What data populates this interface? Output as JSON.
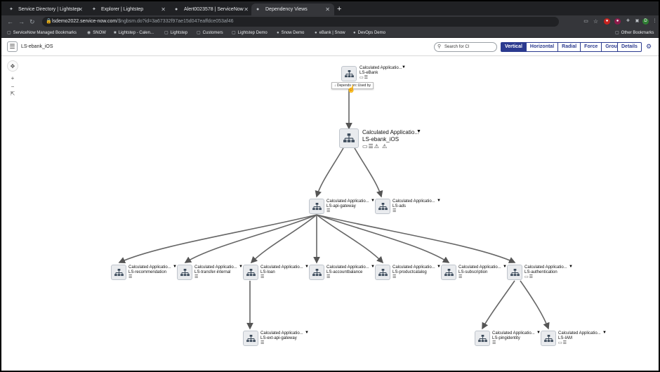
{
  "browser": {
    "tabs": [
      {
        "label": "Service Directory | Lightstep",
        "icon": "lightstep-icon"
      },
      {
        "label": "Explorer | Lightstep",
        "icon": "lightstep-icon"
      },
      {
        "label": "Alert0023578 | ServiceNow",
        "icon": "servicenow-icon"
      },
      {
        "label": "Dependency Views",
        "icon": "servicenow-icon"
      }
    ],
    "new_tab": "+",
    "url_host": "lsdemo2022.service-now.com",
    "url_path": "/$ngbsm.do?id=3a67332f97ae15d047eaffdce053af46",
    "profile_initial": "D",
    "bookmarks": [
      "ServiceNow Managed Bookmarks",
      "SNOW",
      "Lightstep - Calen...",
      "Lightstep",
      "Customers",
      "Lightstep Demo",
      "Snow Demo",
      "eBank | Snow",
      "DevOps Demo"
    ],
    "other_bookmarks": "Other Bookmarks"
  },
  "app": {
    "title": "LS-ebank_iOS",
    "search_placeholder": "Search for CI",
    "views": [
      "Vertical",
      "Horizontal",
      "Radial",
      "Force",
      "Group"
    ],
    "active_view": "Vertical",
    "details_label": "Details"
  },
  "graph": {
    "tooltip": "↓ Depends on::Used by",
    "nodes": [
      {
        "id": "ebank",
        "cls": "Calculated Applicatio...",
        "name": "LS-eBank",
        "badges": "▭☰"
      },
      {
        "id": "ebank_ios",
        "cls": "Calculated Applicatio...",
        "name": "LS-ebank_iOS",
        "badges": "▭☰⚠ ⚠"
      },
      {
        "id": "api_gateway",
        "cls": "Calculated Applicatio...",
        "name": "LS-api-gateway",
        "badges": "☰"
      },
      {
        "id": "ads",
        "cls": "Calculated Applicatio...",
        "name": "LS-ads",
        "badges": "☰"
      },
      {
        "id": "recommendation",
        "cls": "Calculated Applicatio...",
        "name": "LS-recommendation",
        "badges": "☰"
      },
      {
        "id": "transfer_internal",
        "cls": "Calculated Applicatio...",
        "name": "LS-transfer-internal",
        "badges": "☰"
      },
      {
        "id": "loan",
        "cls": "Calculated Applicatio...",
        "name": "LS-loan",
        "badges": "☰"
      },
      {
        "id": "accountbalance",
        "cls": "Calculated Applicatio...",
        "name": "LS-accountbalance",
        "badges": "☰"
      },
      {
        "id": "productcatalog",
        "cls": "Calculated Applicatio...",
        "name": "LS-productcatalog",
        "badges": "☰"
      },
      {
        "id": "subscription",
        "cls": "Calculated Applicatio...",
        "name": "LS-subscription",
        "badges": "☰"
      },
      {
        "id": "authentication",
        "cls": "Calculated Applicatio...",
        "name": "LS-authentication",
        "badges": "▭☰"
      },
      {
        "id": "ext_api_gateway",
        "cls": "Calculated Applicatio...",
        "name": "LS-ext-api-gateway",
        "badges": "☰"
      },
      {
        "id": "pingidentity",
        "cls": "Calculated Applicatio...",
        "name": "LS-pingidentity",
        "badges": "☰"
      },
      {
        "id": "iam",
        "cls": "Calculated Applicatio...",
        "name": "LS-IAM",
        "badges": "▭☰"
      }
    ]
  }
}
